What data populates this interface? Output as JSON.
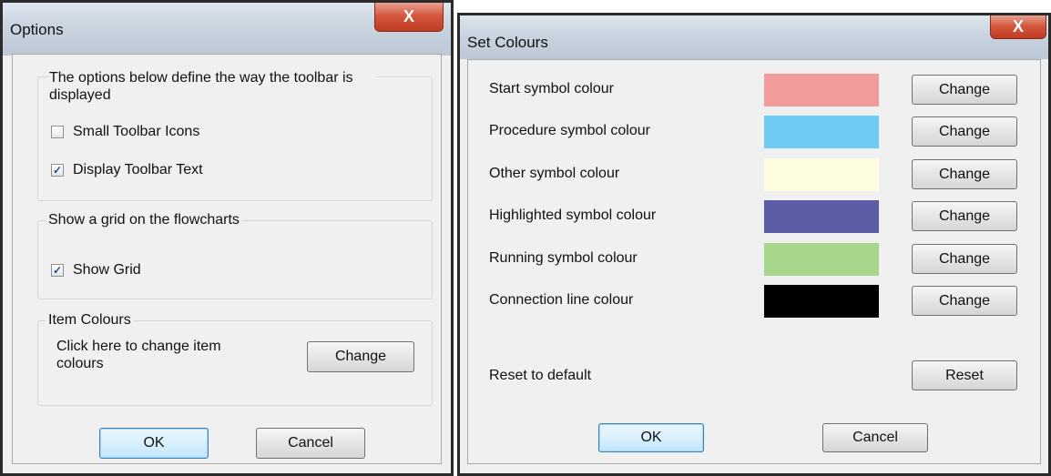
{
  "options_dialog": {
    "title": "Options",
    "close_label": "X",
    "toolbar_group": {
      "description": "The options below define the way the toolbar is displayed",
      "small_icons": {
        "label": "Small Toolbar Icons",
        "checked": false
      },
      "display_text": {
        "label": "Display Toolbar Text",
        "checked": true
      }
    },
    "grid_group": {
      "label": "Show a grid on the flowcharts",
      "show_grid": {
        "label": "Show Grid",
        "checked": true
      }
    },
    "colours_group": {
      "label": "Item Colours",
      "description": "Click here to change item colours",
      "change_label": "Change"
    },
    "ok_label": "OK",
    "cancel_label": "Cancel"
  },
  "colours_dialog": {
    "title": "Set Colours",
    "close_label": "X",
    "rows": [
      {
        "label": "Start symbol colour",
        "color": "#f29b9b",
        "button": "Change"
      },
      {
        "label": "Procedure symbol colour",
        "color": "#6fcbf3",
        "button": "Change"
      },
      {
        "label": "Other symbol colour",
        "color": "#fffde0",
        "button": "Change"
      },
      {
        "label": "Highlighted symbol colour",
        "color": "#5b5ea6",
        "button": "Change"
      },
      {
        "label": "Running symbol colour",
        "color": "#a8d68c",
        "button": "Change"
      },
      {
        "label": "Connection line colour",
        "color": "#000000",
        "button": "Change"
      }
    ],
    "reset": {
      "label": "Reset to default",
      "button": "Reset"
    },
    "ok_label": "OK",
    "cancel_label": "Cancel"
  }
}
